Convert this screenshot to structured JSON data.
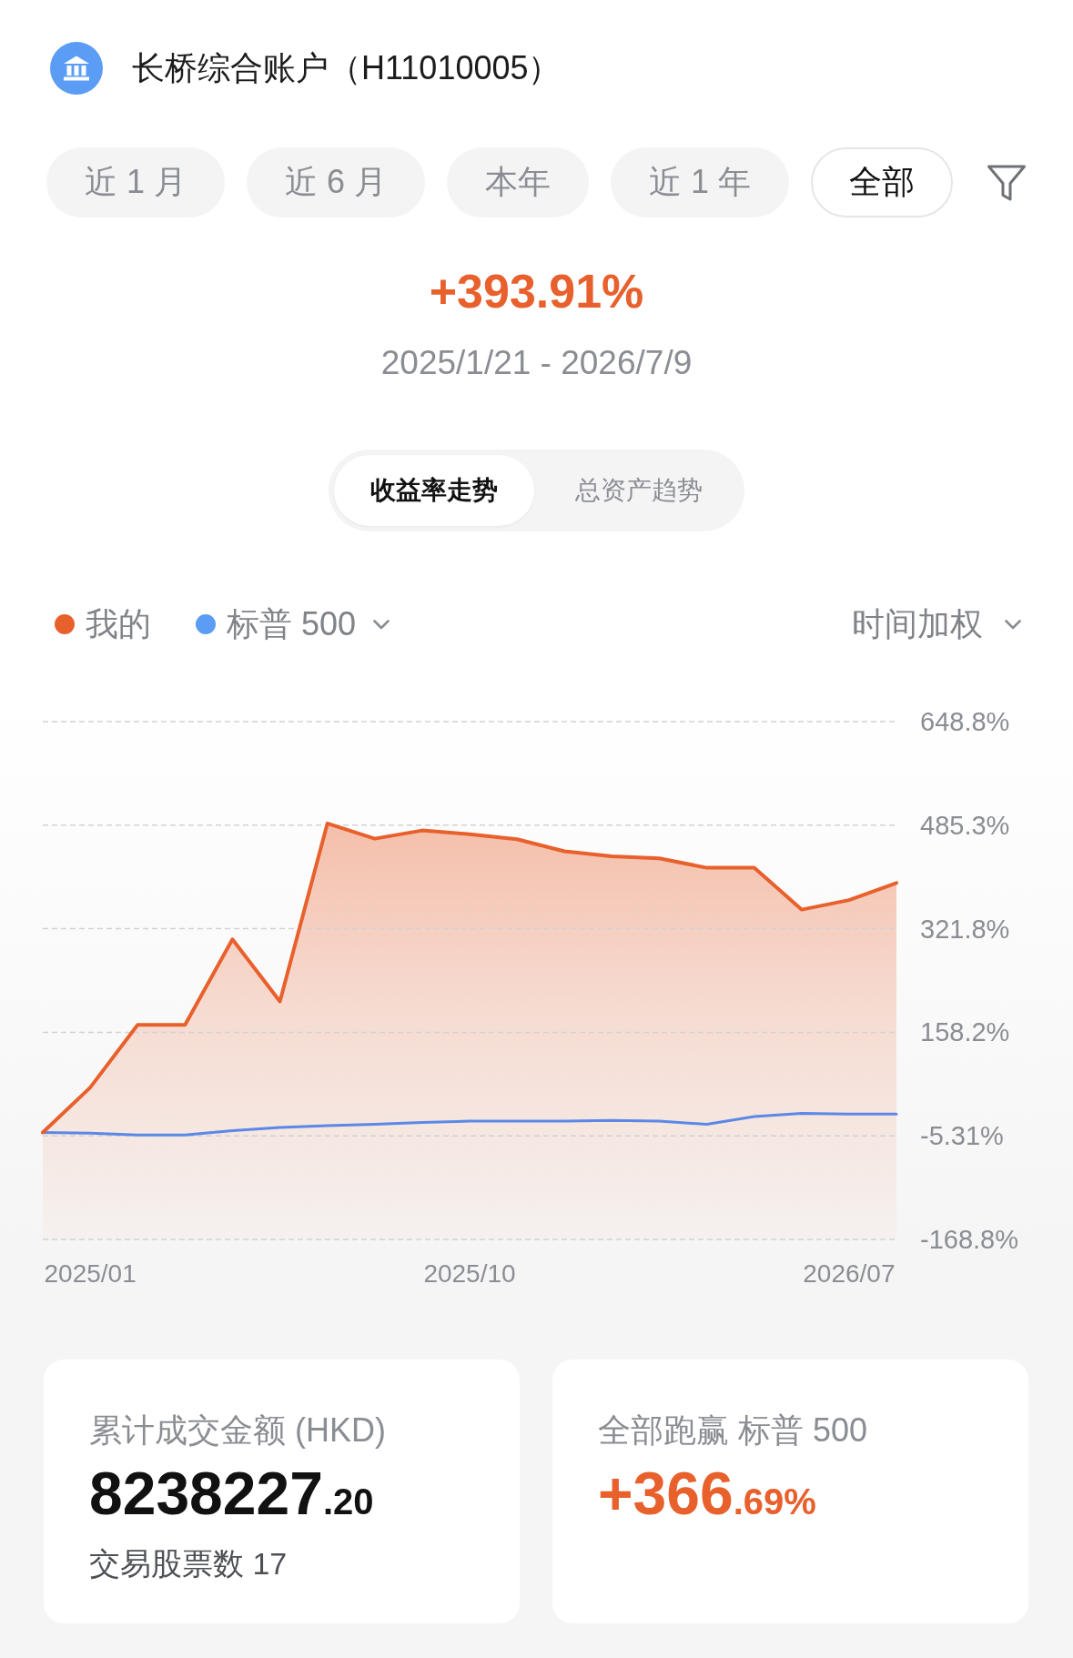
{
  "account": {
    "title": "长桥综合账户（H11010005）"
  },
  "periods": [
    {
      "label": "近 1 月",
      "selected": false
    },
    {
      "label": "近 6 月",
      "selected": false
    },
    {
      "label": "本年",
      "selected": false
    },
    {
      "label": "近 1 年",
      "selected": false
    },
    {
      "label": "全部",
      "selected": true
    }
  ],
  "summary": {
    "return": "+393.91%",
    "date_range": "2025/1/21 - 2026/7/9"
  },
  "trend_tabs": [
    {
      "label": "收益率走势",
      "selected": true
    },
    {
      "label": "总资产趋势",
      "selected": false
    }
  ],
  "legend": {
    "series": [
      {
        "label": "我的",
        "color": "#e8602c",
        "dropdown": false
      },
      {
        "label": "标普 500",
        "color": "#5b9cf5",
        "dropdown": true
      }
    ],
    "method": "时间加权"
  },
  "chart": {
    "chart_data": {
      "type": "area",
      "grid": true,
      "categories": [
        null,
        "2025/01",
        null,
        null,
        null,
        null,
        null,
        null,
        null,
        "2025/10",
        null,
        null,
        null,
        null,
        null,
        null,
        null,
        "2026/07",
        null
      ],
      "ylim": [
        -168.8,
        648.8
      ],
      "yticks": [
        {
          "value": 648.8,
          "label": "648.8%"
        },
        {
          "value": 485.3,
          "label": "485.3%"
        },
        {
          "value": 321.8,
          "label": "321.8%"
        },
        {
          "value": 158.2,
          "label": "158.2%"
        },
        {
          "value": -5.31,
          "label": "-5.31%"
        },
        {
          "value": -168.8,
          "label": "-168.8%"
        }
      ],
      "series": [
        {
          "color": "#e8602c",
          "values": [
            0,
            71,
            170,
            170,
            305,
            207,
            488,
            464,
            477,
            471,
            463,
            444,
            436,
            433,
            418,
            418,
            352,
            367,
            394
          ]
        },
        {
          "type": "line",
          "color": "#5b88e6",
          "values": [
            0,
            -1,
            -4,
            -4,
            3,
            8,
            11,
            13,
            16,
            18,
            18,
            18,
            19,
            18,
            13,
            25,
            30,
            29,
            29
          ]
        }
      ]
    }
  },
  "cards": [
    {
      "label": "累计成交金额 (HKD)",
      "value_main": "8238227",
      "value_fraction": ".20",
      "color": "#111111",
      "note": "交易股票数 17"
    },
    {
      "label": "全部跑赢 标普 500",
      "value_main": "+366",
      "value_fraction": ".69%",
      "color": "#e8602c"
    }
  ]
}
